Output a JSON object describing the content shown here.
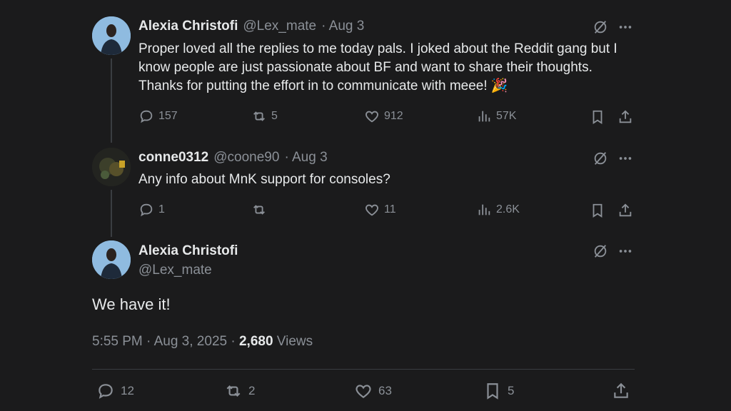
{
  "tweet1": {
    "name": "Alexia Christofi",
    "handle": "@Lex_mate",
    "date": "· Aug 3",
    "text": "Proper loved all the replies to me today pals. I joked about the Reddit gang but I know people are just passionate about BF and want to share their thoughts. Thanks for putting the effort in to communicate with meee! 🎉",
    "replies": "157",
    "retweets": "5",
    "likes": "912",
    "views": "57K"
  },
  "tweet2": {
    "name": "conne0312",
    "handle": "@coone90",
    "date": "· Aug 3",
    "text": "Any info about MnK support for consoles?",
    "replies": "1",
    "retweets": "",
    "likes": "11",
    "views": "2.6K"
  },
  "main_tweet": {
    "name": "Alexia Christofi",
    "handle": "@Lex_mate",
    "text": "We have it!",
    "timestamp": "5:55 PM · Aug 3, 2025 · ",
    "views_count": "2,680",
    "views_label": " Views",
    "replies": "12",
    "retweets": "2",
    "likes": "63",
    "bookmarks": "5"
  },
  "colors": {
    "background": "#1b1b1c",
    "primary_text": "#e7e9ea",
    "secondary_text": "#8b9097",
    "divider": "#3a3d41"
  },
  "icons": [
    "grok-icon",
    "more-icon",
    "reply-icon",
    "retweet-icon",
    "like-icon",
    "views-icon",
    "bookmark-icon",
    "share-icon"
  ]
}
